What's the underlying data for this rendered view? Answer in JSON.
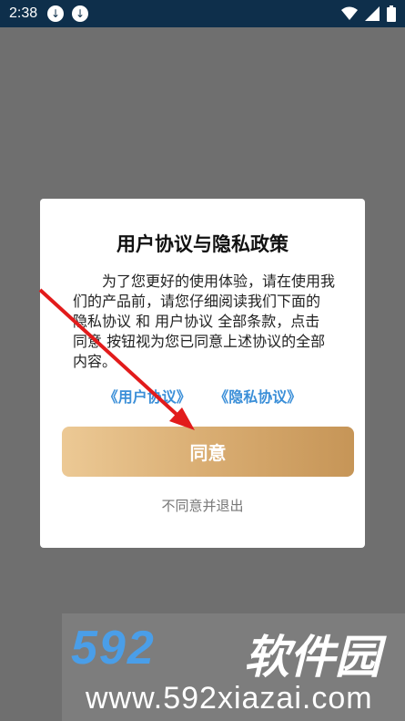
{
  "status_bar": {
    "time": "2:38"
  },
  "dialog": {
    "title": "用户协议与隐私政策",
    "body": "为了您更好的使用体验，请在使用我们的产品前，请您仔细阅读我们下面的 隐私协议 和 用户协议 全部条款，点击 同意 按钮视为您已同意上述协议的全部内容。",
    "user_agreement_link": "《用户协议》",
    "privacy_link": "《隐私协议》",
    "agree_label": "同意",
    "disagree_label": "不同意并退出"
  },
  "watermark": {
    "logo_number": "592",
    "logo_text": "软件园",
    "url": "www.592xiazai.com"
  },
  "colors": {
    "status_bar": "#0e2f4b",
    "link": "#3b8fd8",
    "agree_start": "#ecc995",
    "agree_end": "#c69557",
    "arrow": "#e21b1b"
  }
}
